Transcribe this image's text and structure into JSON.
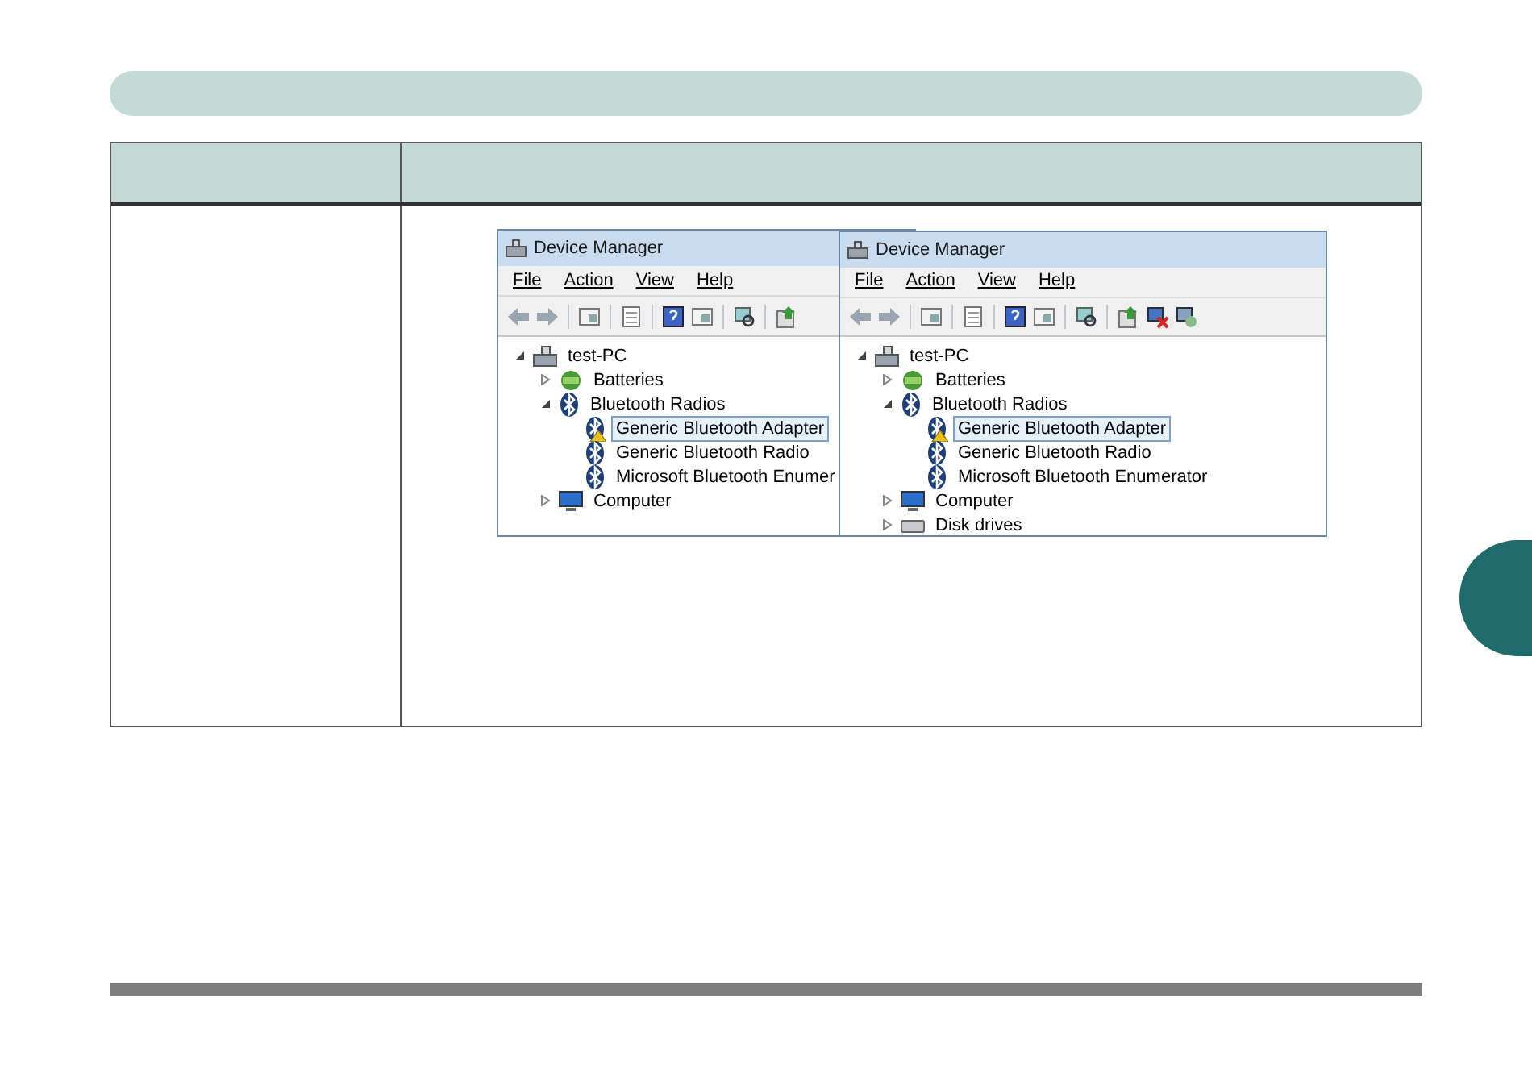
{
  "windows": [
    {
      "title": "Device Manager",
      "menu": [
        "File",
        "Action",
        "View",
        "Help"
      ],
      "toolbar": [
        {
          "kind": "back"
        },
        {
          "kind": "forward"
        },
        {
          "kind": "sep"
        },
        {
          "kind": "panel"
        },
        {
          "kind": "sep"
        },
        {
          "kind": "doc"
        },
        {
          "kind": "sep"
        },
        {
          "kind": "help"
        },
        {
          "kind": "panel"
        },
        {
          "kind": "sep"
        },
        {
          "kind": "scan"
        },
        {
          "kind": "sep"
        },
        {
          "kind": "update"
        }
      ],
      "tree": [
        {
          "label": "test-PC",
          "kind": "pc",
          "expanded": true,
          "selected": false,
          "children": [
            {
              "label": "Batteries",
              "kind": "battery",
              "expanded": false,
              "selected": false
            },
            {
              "label": "Bluetooth Radios",
              "kind": "bluetooth",
              "expanded": true,
              "selected": false,
              "children": [
                {
                  "label": "Generic Bluetooth Adapter",
                  "kind": "bluetooth-warning",
                  "selected": true
                },
                {
                  "label": "Generic Bluetooth Radio",
                  "kind": "bluetooth",
                  "selected": false
                },
                {
                  "label": "Microsoft Bluetooth Enumer",
                  "kind": "bluetooth",
                  "selected": false
                }
              ]
            },
            {
              "label": "Computer",
              "kind": "computer",
              "expanded": false,
              "selected": false
            }
          ]
        }
      ]
    },
    {
      "title": "Device Manager",
      "menu": [
        "File",
        "Action",
        "View",
        "Help"
      ],
      "toolbar": [
        {
          "kind": "back"
        },
        {
          "kind": "forward"
        },
        {
          "kind": "sep"
        },
        {
          "kind": "panel"
        },
        {
          "kind": "sep"
        },
        {
          "kind": "doc"
        },
        {
          "kind": "sep"
        },
        {
          "kind": "help"
        },
        {
          "kind": "panel"
        },
        {
          "kind": "sep"
        },
        {
          "kind": "scan"
        },
        {
          "kind": "sep"
        },
        {
          "kind": "update"
        },
        {
          "kind": "remove"
        },
        {
          "kind": "enable"
        }
      ],
      "tree": [
        {
          "label": "test-PC",
          "kind": "pc",
          "expanded": true,
          "selected": false,
          "children": [
            {
              "label": "Batteries",
              "kind": "battery",
              "expanded": false,
              "selected": false
            },
            {
              "label": "Bluetooth Radios",
              "kind": "bluetooth",
              "expanded": true,
              "selected": false,
              "children": [
                {
                  "label": "Generic Bluetooth Adapter",
                  "kind": "bluetooth-warning",
                  "selected": true
                },
                {
                  "label": "Generic Bluetooth Radio",
                  "kind": "bluetooth",
                  "selected": false
                },
                {
                  "label": "Microsoft Bluetooth Enumerator",
                  "kind": "bluetooth",
                  "selected": false
                }
              ]
            },
            {
              "label": "Computer",
              "kind": "computer",
              "expanded": false,
              "selected": false
            },
            {
              "label": "Disk drives",
              "kind": "disk",
              "expanded": false,
              "selected": false
            }
          ]
        }
      ]
    }
  ]
}
